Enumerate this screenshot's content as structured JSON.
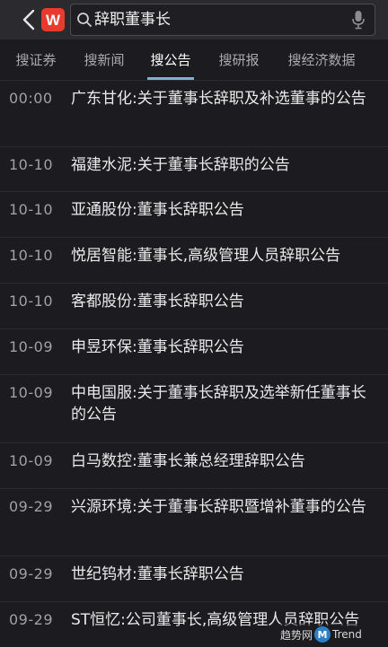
{
  "header": {
    "logo_label": "W",
    "search_value": "辞职董事长"
  },
  "tabs": [
    {
      "label": "搜证券",
      "active": false
    },
    {
      "label": "搜新闻",
      "active": false
    },
    {
      "label": "搜公告",
      "active": true
    },
    {
      "label": "搜研报",
      "active": false
    },
    {
      "label": "搜经济数据",
      "active": false
    }
  ],
  "results": [
    {
      "date": "00:00",
      "title": "广东甘化:关于董事长辞职及补选董事的公告"
    },
    {
      "date": "10-10",
      "title": "福建水泥:关于董事长辞职的公告"
    },
    {
      "date": "10-10",
      "title": "亚通股份:董事长辞职公告"
    },
    {
      "date": "10-10",
      "title": "悦居智能:董事长,高级管理人员辞职公告"
    },
    {
      "date": "10-10",
      "title": "客都股份:董事长辞职公告"
    },
    {
      "date": "10-09",
      "title": "申昱环保:董事长辞职公告"
    },
    {
      "date": "10-09",
      "title": "中电国服:关于董事长辞职及选举新任董事长的公告"
    },
    {
      "date": "10-09",
      "title": "白马数控:董事长兼总经理辞职公告"
    },
    {
      "date": "09-29",
      "title": "兴源环境:关于董事长辞职暨增补董事的公告"
    },
    {
      "date": "09-29",
      "title": "世纪钨材:董事长辞职公告"
    },
    {
      "date": "09-29",
      "title": "ST恒忆:公司董事长,高级管理人员辞职公告"
    }
  ],
  "watermark": {
    "text": "趋势网",
    "badge": "M",
    "brand": "Trend"
  },
  "colors": {
    "background": "#1c1c20",
    "topbar": "#2a2a2f",
    "logo": "#e83b2e",
    "tab_active_underline": "#7fb2c9"
  }
}
